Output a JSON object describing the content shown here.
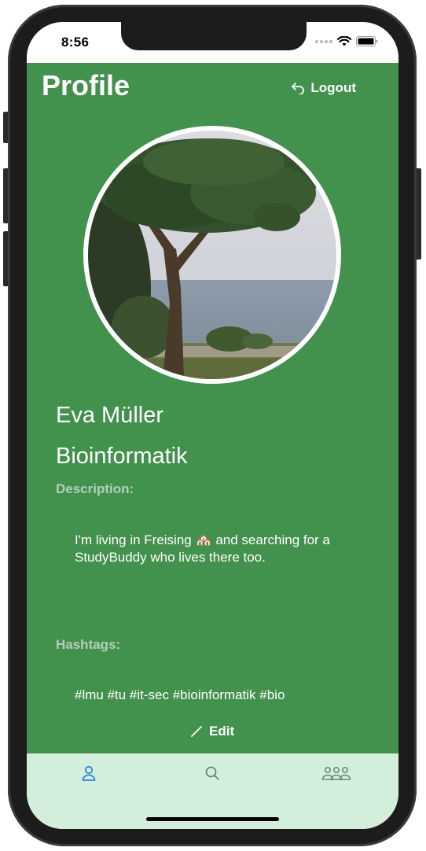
{
  "status_bar": {
    "time": "8:56"
  },
  "header": {
    "title": "Profile",
    "logout_label": "Logout"
  },
  "profile": {
    "name": "Eva Müller",
    "major": "Bioinformatik",
    "description_label": "Description:",
    "description_text": "I'm living in Freising 🏘️ and searching for a StudyBuddy who lives there too.",
    "hashtags_label": "Hashtags:",
    "hashtags_text": "#lmu #tu #it-sec #bioinformatik #bio"
  },
  "actions": {
    "edit_label": "Edit"
  },
  "tab_bar": {
    "items": [
      {
        "name": "profile",
        "icon": "person-icon",
        "active": true
      },
      {
        "name": "search",
        "icon": "search-icon",
        "active": false
      },
      {
        "name": "groups",
        "icon": "people-icon",
        "active": false
      }
    ]
  },
  "colors": {
    "primary_green": "#42914d",
    "tab_bar_bg": "#d3efdc",
    "active_tab": "#2f80ed",
    "inactive_tab": "#6b8a72",
    "label_muted": "#b7cfb9"
  }
}
